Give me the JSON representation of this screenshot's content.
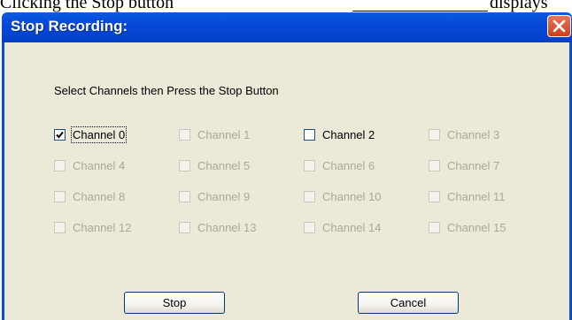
{
  "background_doc": {
    "text_before": "Clicking the Stop button",
    "text_after": "displays"
  },
  "dialog": {
    "title": "Stop Recording:",
    "instruction": "Select Channels then Press the Stop Button",
    "channels": [
      {
        "label": "Channel 0",
        "checked": true,
        "enabled": true
      },
      {
        "label": "Channel 1",
        "checked": false,
        "enabled": false
      },
      {
        "label": "Channel 2",
        "checked": false,
        "enabled": true
      },
      {
        "label": "Channel 3",
        "checked": false,
        "enabled": false
      },
      {
        "label": "Channel 4",
        "checked": false,
        "enabled": false
      },
      {
        "label": "Channel 5",
        "checked": false,
        "enabled": false
      },
      {
        "label": "Channel 6",
        "checked": false,
        "enabled": false
      },
      {
        "label": "Channel 7",
        "checked": false,
        "enabled": false
      },
      {
        "label": "Channel 8",
        "checked": false,
        "enabled": false
      },
      {
        "label": "Channel 9",
        "checked": false,
        "enabled": false
      },
      {
        "label": "Channel 10",
        "checked": false,
        "enabled": false
      },
      {
        "label": "Channel 11",
        "checked": false,
        "enabled": false
      },
      {
        "label": "Channel 12",
        "checked": false,
        "enabled": false
      },
      {
        "label": "Channel 13",
        "checked": false,
        "enabled": false
      },
      {
        "label": "Channel 14",
        "checked": false,
        "enabled": false
      },
      {
        "label": "Channel 15",
        "checked": false,
        "enabled": false
      }
    ],
    "stop_label": "Stop",
    "cancel_label": "Cancel"
  },
  "icons": {
    "close": "close-icon",
    "check": "checkmark-icon"
  },
  "colors": {
    "titlebar": "#0649d8",
    "dialog_bg": "#ece9d8",
    "disabled_text": "#aca899",
    "close_button": "#d8522e"
  }
}
